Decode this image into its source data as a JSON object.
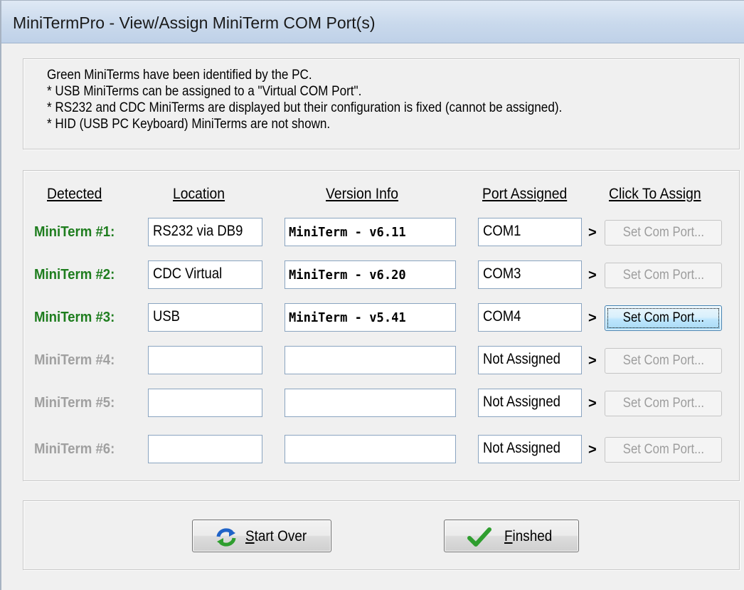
{
  "window": {
    "title": "MiniTermPro - View/Assign MiniTerm COM Port(s)"
  },
  "info": {
    "lines": [
      "Green MiniTerms have been identified by the PC.",
      " * USB MiniTerms can  be assigned to a \"Virtual COM Port\".",
      " * RS232 and CDC MiniTerms are displayed but their configuration is fixed  (cannot be assigned).",
      " * HID (USB PC Keyboard) MiniTerms are not shown."
    ]
  },
  "table": {
    "headers": {
      "detected": "Detected",
      "location": "Location",
      "version": "Version Info",
      "port": "Port Assigned",
      "assign": "Click To Assign"
    },
    "arrow": ">",
    "rows": [
      {
        "label": "MiniTerm #1:",
        "location": "RS232 via DB9",
        "version": "MiniTerm - v6.11",
        "port": "COM1",
        "button": "Set Com Port...",
        "identified": true,
        "button_enabled": false
      },
      {
        "label": "MiniTerm #2:",
        "location": "CDC Virtual",
        "version": "MiniTerm - v6.20",
        "port": "COM3",
        "button": "Set Com Port...",
        "identified": true,
        "button_enabled": false
      },
      {
        "label": "MiniTerm #3:",
        "location": "USB",
        "version": "MiniTerm - v5.41",
        "port": "COM4",
        "button": "Set Com Port...",
        "identified": true,
        "button_enabled": true
      },
      {
        "label": "MiniTerm #4:",
        "location": "",
        "version": "",
        "port": "Not Assigned",
        "button": "Set Com Port...",
        "identified": false,
        "button_enabled": false
      },
      {
        "label": "MiniTerm #5:",
        "location": "",
        "version": "",
        "port": "Not Assigned",
        "button": "Set Com Port...",
        "identified": false,
        "button_enabled": false
      },
      {
        "label": "MiniTerm #6:",
        "location": "",
        "version": "",
        "port": "Not Assigned",
        "button": "Set Com Port...",
        "identified": false,
        "button_enabled": false
      }
    ]
  },
  "buttons": {
    "start_over": {
      "accel": "S",
      "rest": "tart Over",
      "icon": "refresh-icon"
    },
    "finished": {
      "accel": "F",
      "rest": "inshed",
      "icon": "checkmark-icon"
    }
  },
  "colors": {
    "identified": "#1e7d1e",
    "unidentified": "#a0a0a0",
    "icon_green": "#2f9e2f",
    "icon_blue": "#1f63c8"
  }
}
